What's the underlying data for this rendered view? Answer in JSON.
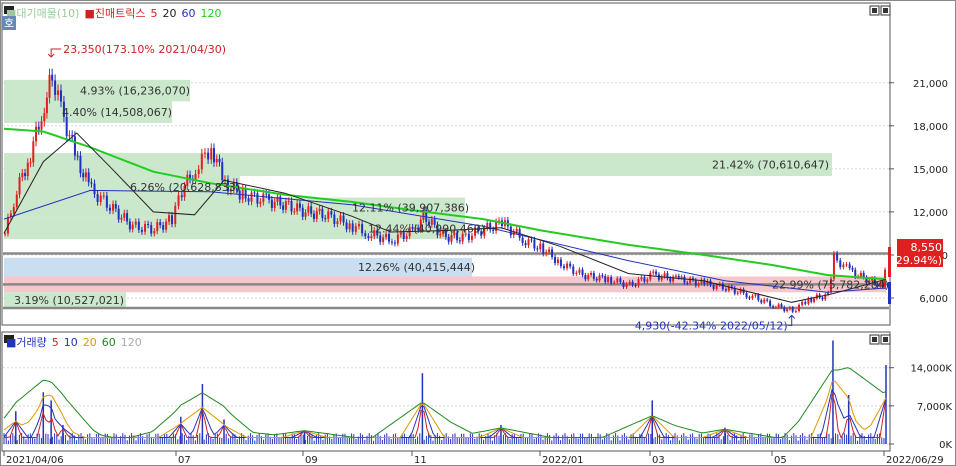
{
  "price_panel": {
    "legend_items": [
      {
        "text": "■대기매물(10)",
        "color": "#9cc99c"
      },
      {
        "text": "■진매트릭스",
        "color": "#cc2222"
      },
      {
        "text": "5",
        "color": "#cc2222"
      },
      {
        "text": "20",
        "color": "#222222"
      },
      {
        "text": "60",
        "color": "#2233bb"
      },
      {
        "text": "120",
        "color": "#22cc22"
      }
    ],
    "side_tag": "호",
    "y_ticks": [
      "21,000",
      "18,000",
      "15,000",
      "12,000",
      "9,000",
      "6,000"
    ],
    "current_price": "8,550",
    "current_change": "( 29.94%)",
    "high_annotation": "23,350(173.10% 2021/04/30)",
    "low_annotation": "4,930(-42.34% 2022/05/12)",
    "supply_zones": [
      {
        "label": "4.93% (16,236,070)",
        "color": "#c8e6c9"
      },
      {
        "label": "4.40% (14,508,067)",
        "color": "#c8e6c9"
      },
      {
        "label": "21.42% (70,610,647)",
        "color": "#c8e6c9"
      },
      {
        "label": "6.26% (20,628,833)",
        "color": "#c8e6c9"
      },
      {
        "label": "12.11% (39,907,386)",
        "color": "#c8e6c9"
      },
      {
        "label": "12.44% (40,990,469)",
        "color": "#c8e6c9"
      },
      {
        "label": "12.26% (40,415,444)",
        "color": "#c6dcef"
      },
      {
        "label": "22.99% (75,782,284)",
        "color": "#f4c4c8"
      },
      {
        "label": "3.19% (10,527,021)",
        "color": "#c8e6c9"
      }
    ]
  },
  "volume_panel": {
    "legend_items": [
      {
        "text": "■거래량",
        "color": "#2233bb"
      },
      {
        "text": "5",
        "color": "#cc2222"
      },
      {
        "text": "10",
        "color": "#2233bb"
      },
      {
        "text": "20",
        "color": "#dd9900"
      },
      {
        "text": "60",
        "color": "#228822"
      },
      {
        "text": "120",
        "color": "#aaaaaa"
      }
    ],
    "y_ticks": [
      "14,000K",
      "7,000K",
      "0K"
    ]
  },
  "x_axis": {
    "labels": [
      "2021/04/06",
      "07",
      "09",
      "11",
      "2022/01",
      "03",
      "05",
      "2022/06/29"
    ]
  },
  "chart_data": {
    "type": "candlestick",
    "x_start": "2021/04/06",
    "x_end": "2022/06/29",
    "price_ylim": [
      4000,
      24000
    ],
    "volume_ylim": [
      0,
      20000
    ],
    "volume_unit": "K",
    "high": {
      "date": "2021/04/30",
      "price": 23350,
      "change_pct": 173.1
    },
    "low": {
      "date": "2022/05/12",
      "price": 4930,
      "change_pct": -42.34
    },
    "last": {
      "date": "2022/06/29",
      "price": 8550,
      "change_pct": 29.94
    },
    "supply_zones": [
      {
        "pct": 4.93,
        "volume": 16236070,
        "price_range": [
          19700,
          21200
        ]
      },
      {
        "pct": 4.4,
        "volume": 14508067,
        "price_range": [
          18200,
          19700
        ]
      },
      {
        "pct": 21.42,
        "volume": 70610647,
        "price_range": [
          14500,
          16100
        ]
      },
      {
        "pct": 6.26,
        "volume": 20628833,
        "price_range": [
          13000,
          14500
        ]
      },
      {
        "pct": 12.11,
        "volume": 39907386,
        "price_range": [
          11600,
          13000
        ]
      },
      {
        "pct": 12.44,
        "volume": 40990469,
        "price_range": [
          10100,
          11600
        ]
      },
      {
        "pct": 12.26,
        "volume": 40415444,
        "price_range": [
          7500,
          8800
        ]
      },
      {
        "pct": 22.99,
        "volume": 75782284,
        "price_range": [
          6400,
          7500
        ]
      },
      {
        "pct": 3.19,
        "volume": 10527021,
        "price_range": [
          5300,
          6400
        ]
      }
    ],
    "price_series": [
      {
        "date": "2021/04/06",
        "close": 10500
      },
      {
        "date": "2021/04/12",
        "close": 13500
      },
      {
        "date": "2021/04/19",
        "close": 16000
      },
      {
        "date": "2021/04/26",
        "close": 19500
      },
      {
        "date": "2021/04/30",
        "close": 21500
      },
      {
        "date": "2021/05/06",
        "close": 18500
      },
      {
        "date": "2021/05/13",
        "close": 15500
      },
      {
        "date": "2021/05/20",
        "close": 13500
      },
      {
        "date": "2021/05/31",
        "close": 12200
      },
      {
        "date": "2021/06/10",
        "close": 11000
      },
      {
        "date": "2021/06/21",
        "close": 10800
      },
      {
        "date": "2021/06/30",
        "close": 11500
      },
      {
        "date": "2021/07/05",
        "close": 13500
      },
      {
        "date": "2021/07/12",
        "close": 15000
      },
      {
        "date": "2021/07/20",
        "close": 16500
      },
      {
        "date": "2021/07/27",
        "close": 14000
      },
      {
        "date": "2021/08/05",
        "close": 13200
      },
      {
        "date": "2021/08/17",
        "close": 12800
      },
      {
        "date": "2021/08/27",
        "close": 12500
      },
      {
        "date": "2021/09/06",
        "close": 12000
      },
      {
        "date": "2021/09/16",
        "close": 11800
      },
      {
        "date": "2021/09/30",
        "close": 11000
      },
      {
        "date": "2021/10/08",
        "close": 10500
      },
      {
        "date": "2021/10/20",
        "close": 10000
      },
      {
        "date": "2021/11/01",
        "close": 10800
      },
      {
        "date": "2021/11/05",
        "close": 11800
      },
      {
        "date": "2021/11/15",
        "close": 10300
      },
      {
        "date": "2021/11/25",
        "close": 10200
      },
      {
        "date": "2021/12/06",
        "close": 10800
      },
      {
        "date": "2021/12/15",
        "close": 11200
      },
      {
        "date": "2021/12/27",
        "close": 10000
      },
      {
        "date": "2022/01/05",
        "close": 9400
      },
      {
        "date": "2022/01/14",
        "close": 8400
      },
      {
        "date": "2022/01/25",
        "close": 7600
      },
      {
        "date": "2022/02/07",
        "close": 7300
      },
      {
        "date": "2022/02/18",
        "close": 6900
      },
      {
        "date": "2022/03/02",
        "close": 7600
      },
      {
        "date": "2022/03/15",
        "close": 7300
      },
      {
        "date": "2022/03/28",
        "close": 7000
      },
      {
        "date": "2022/04/08",
        "close": 6700
      },
      {
        "date": "2022/04/20",
        "close": 6200
      },
      {
        "date": "2022/05/02",
        "close": 5500
      },
      {
        "date": "2022/05/12",
        "close": 5100
      },
      {
        "date": "2022/05/20",
        "close": 5900
      },
      {
        "date": "2022/05/30",
        "close": 6200
      },
      {
        "date": "2022/06/02",
        "close": 8800
      },
      {
        "date": "2022/06/10",
        "close": 7900
      },
      {
        "date": "2022/06/20",
        "close": 7200
      },
      {
        "date": "2022/06/27",
        "close": 6900
      },
      {
        "date": "2022/06/29",
        "close": 8550
      }
    ],
    "ma120_series": [
      {
        "date": "2021/04/06",
        "value": 17800
      },
      {
        "date": "2021/04/26",
        "value": 17600
      },
      {
        "date": "2021/05/20",
        "value": 16500
      },
      {
        "date": "2021/06/21",
        "value": 14800
      },
      {
        "date": "2021/07/20",
        "value": 14000
      },
      {
        "date": "2021/08/27",
        "value": 13200
      },
      {
        "date": "2021/09/30",
        "value": 12700
      },
      {
        "date": "2021/11/01",
        "value": 12100
      },
      {
        "date": "2021/12/06",
        "value": 11500
      },
      {
        "date": "2022/01/05",
        "value": 10700
      },
      {
        "date": "2022/02/18",
        "value": 9700
      },
      {
        "date": "2022/03/28",
        "value": 9000
      },
      {
        "date": "2022/05/02",
        "value": 8300
      },
      {
        "date": "2022/05/30",
        "value": 7600
      },
      {
        "date": "2022/06/29",
        "value": 7300
      }
    ],
    "ma60_series": [
      {
        "date": "2021/04/06",
        "value": 11500
      },
      {
        "date": "2021/05/20",
        "value": 13500
      },
      {
        "date": "2021/07/20",
        "value": 13400
      },
      {
        "date": "2021/09/30",
        "value": 12500
      },
      {
        "date": "2021/12/06",
        "value": 11000
      },
      {
        "date": "2022/02/18",
        "value": 8600
      },
      {
        "date": "2022/04/08",
        "value": 7200
      },
      {
        "date": "2022/05/30",
        "value": 6400
      },
      {
        "date": "2022/06/29",
        "value": 6700
      }
    ],
    "ma20_series": [
      {
        "date": "2021/04/06",
        "value": 10500
      },
      {
        "date": "2021/04/26",
        "value": 15500
      },
      {
        "date": "2021/05/13",
        "value": 17500
      },
      {
        "date": "2021/05/31",
        "value": 15000
      },
      {
        "date": "2021/06/21",
        "value": 12000
      },
      {
        "date": "2021/07/12",
        "value": 11800
      },
      {
        "date": "2021/07/27",
        "value": 14200
      },
      {
        "date": "2021/08/27",
        "value": 13300
      },
      {
        "date": "2021/09/30",
        "value": 11700
      },
      {
        "date": "2021/10/20",
        "value": 10600
      },
      {
        "date": "2021/11/15",
        "value": 10700
      },
      {
        "date": "2021/12/15",
        "value": 10900
      },
      {
        "date": "2022/01/14",
        "value": 9600
      },
      {
        "date": "2022/02/18",
        "value": 7700
      },
      {
        "date": "2022/03/28",
        "value": 7200
      },
      {
        "date": "2022/05/12",
        "value": 5700
      },
      {
        "date": "2022/06/02",
        "value": 6300
      },
      {
        "date": "2022/06/29",
        "value": 7300
      }
    ],
    "volume_spikes": [
      {
        "date": "2021/04/12",
        "value": 6000
      },
      {
        "date": "2021/04/26",
        "value": 9500
      },
      {
        "date": "2021/04/30",
        "value": 8000
      },
      {
        "date": "2021/05/06",
        "value": 3500
      },
      {
        "date": "2021/07/05",
        "value": 5000
      },
      {
        "date": "2021/07/16",
        "value": 11000
      },
      {
        "date": "2021/07/27",
        "value": 4500
      },
      {
        "date": "2021/09/06",
        "value": 2500
      },
      {
        "date": "2021/11/05",
        "value": 13000
      },
      {
        "date": "2021/12/15",
        "value": 3500
      },
      {
        "date": "2022/03/02",
        "value": 8000
      },
      {
        "date": "2022/04/08",
        "value": 3000
      },
      {
        "date": "2022/06/02",
        "value": 19000
      },
      {
        "date": "2022/06/10",
        "value": 9000
      },
      {
        "date": "2022/06/29",
        "value": 14500
      }
    ]
  }
}
